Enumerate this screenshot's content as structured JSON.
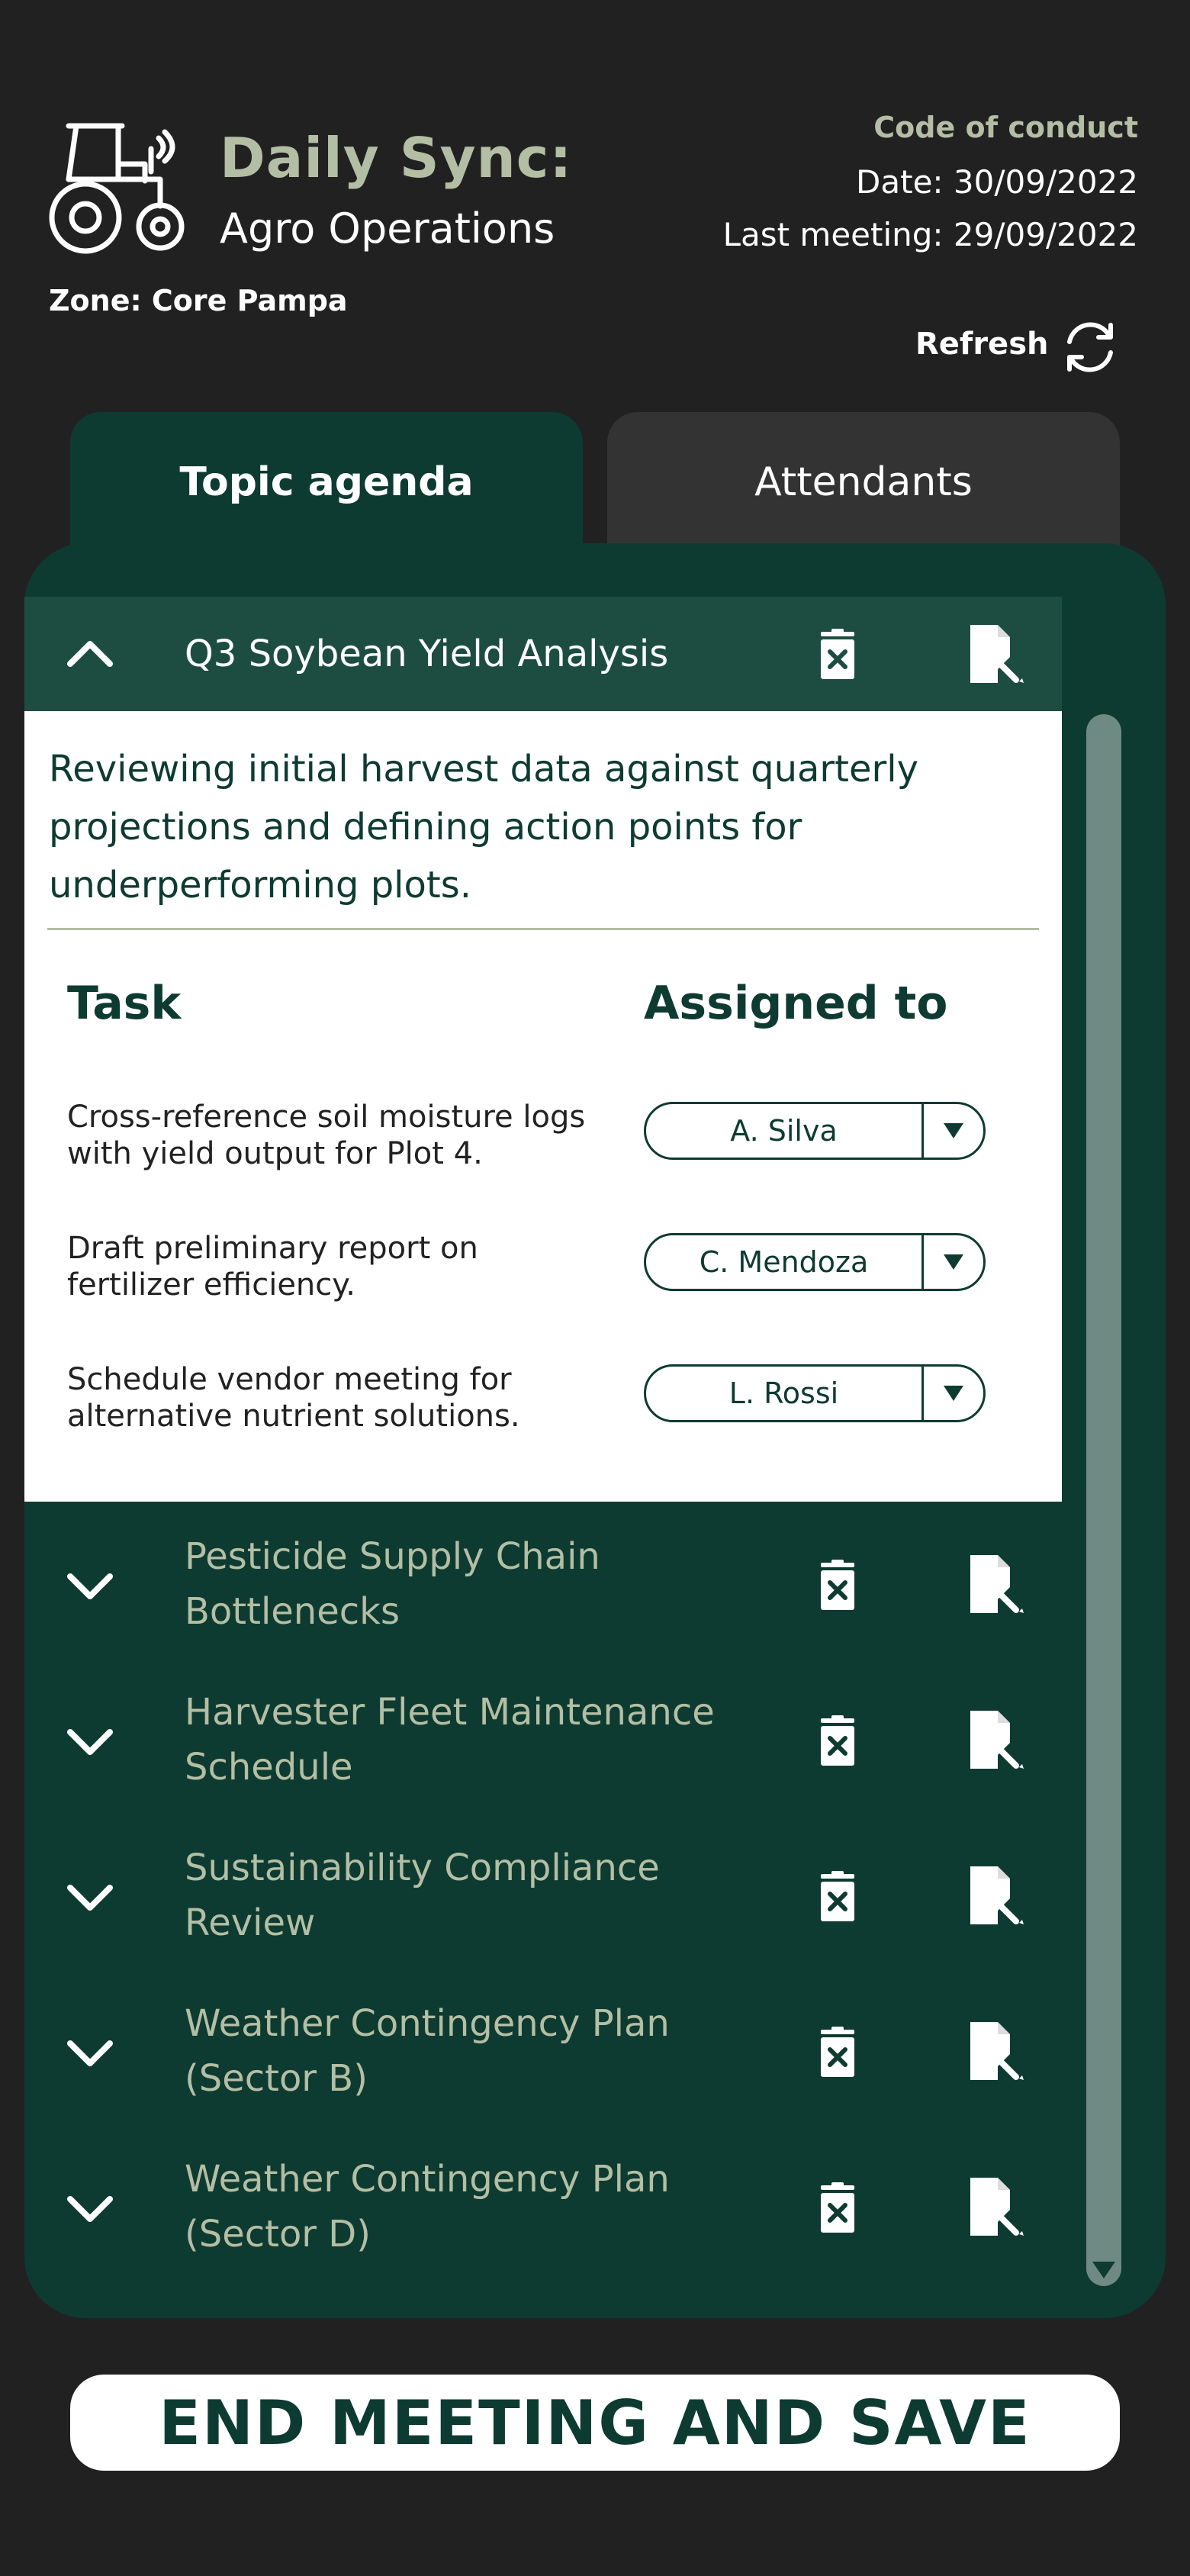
{
  "header": {
    "title_line1": "Daily Sync:",
    "title_line2": "Agro Operations",
    "zone": "Zone: Core Pampa",
    "code_of_conduct": "Code of conduct",
    "date": "Date: 30/09/2022",
    "last_meeting": "Last meeting: 29/09/2022",
    "refresh_label": "Refresh"
  },
  "tabs": [
    {
      "label": "Topic agenda",
      "active": true
    },
    {
      "label": "Attendants",
      "active": false
    }
  ],
  "topics": [
    {
      "title": "Q3 Soybean Yield Analysis",
      "expanded": true,
      "description": "Reviewing initial harvest data against quarterly projections and defining action points for underperforming plots.",
      "columns": {
        "task": "Task",
        "assigned": "Assigned to"
      },
      "tasks": [
        {
          "text": "Cross-reference soil moisture logs with yield output for Plot 4.",
          "assignee": "A. Silva"
        },
        {
          "text": "Draft preliminary report on fertilizer efficiency.",
          "assignee": "C. Mendoza"
        },
        {
          "text": "Schedule vendor meeting for alternative nutrient solutions.",
          "assignee": "L. Rossi"
        }
      ]
    },
    {
      "title": "Pesticide Supply Chain Bottlenecks",
      "expanded": false
    },
    {
      "title": "Harvester Fleet Maintenance Schedule",
      "expanded": false
    },
    {
      "title": "Sustainability Compliance Review",
      "expanded": false
    },
    {
      "title": "Weather Contingency Plan (Sector B)",
      "expanded": false
    },
    {
      "title": "Weather Contingency Plan (Sector D)",
      "expanded": false
    }
  ],
  "end_button": "END MEETING AND SAVE",
  "colors": {
    "background": "#212121",
    "panel": "#0e3b31",
    "accent_sage": "#b3bea4",
    "tab_inactive": "#333333",
    "scrollbar": "#6e8a82"
  },
  "icons": {
    "logo": "tractor-icon",
    "refresh": "refresh-icon",
    "expand": "chevron-down-icon",
    "collapse": "chevron-up-icon",
    "delete": "trash-icon",
    "edit": "edit-document-icon"
  }
}
